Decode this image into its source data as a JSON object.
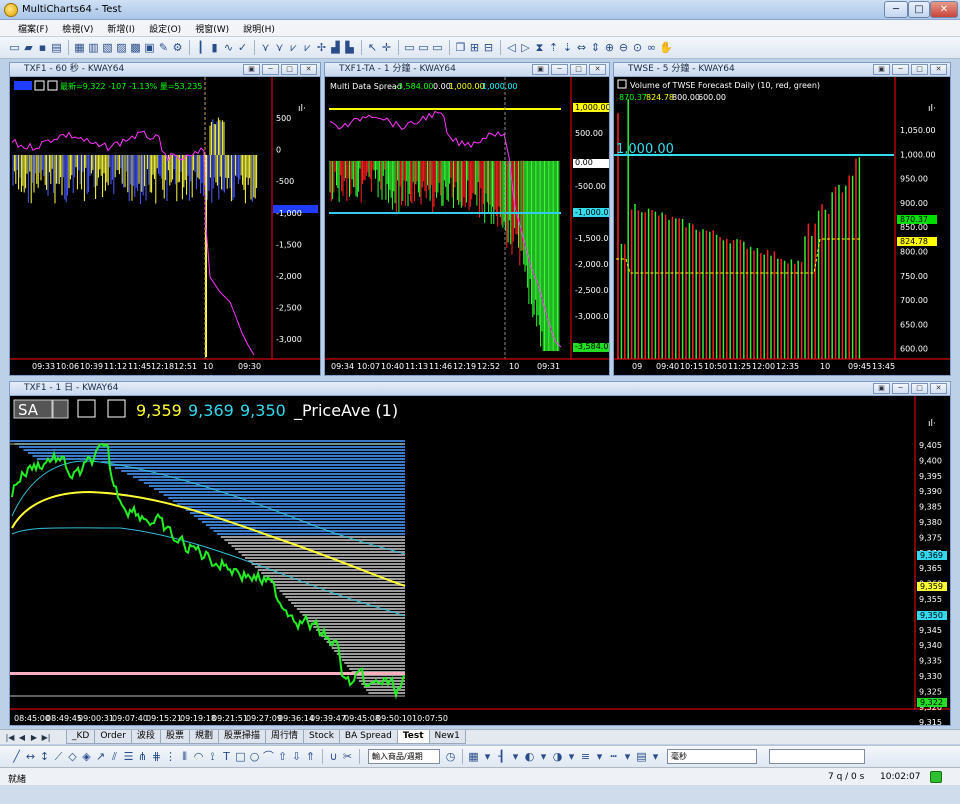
{
  "window": {
    "title": "MultiCharts64 - Test"
  },
  "menu": [
    "檔案(F)",
    "檢視(V)",
    "新增(I)",
    "設定(O)",
    "視窗(W)",
    "說明(H)"
  ],
  "panels": {
    "p1": {
      "title": "TXF1 - 60 秒 - KWAY64",
      "legend": "最新=9,322  -107  -1.13%  量=53,235",
      "yticks": [
        "500",
        "0",
        "-500",
        "-1,000",
        "-1,500",
        "-2,000",
        "-2,500",
        "-3,000"
      ],
      "xticks": [
        "09:33",
        "10:06",
        "10:39",
        "11:12",
        "11:45",
        "12:18",
        "12:51",
        "10",
        "09:30"
      ]
    },
    "p2": {
      "title": "TXF1-TA - 1 分鐘 - KWAY64",
      "legend_name": "Multi Data Spread",
      "legend_values": [
        "-3,584.00",
        "0.00",
        "1,000.00",
        "-1,000.00"
      ],
      "yticks": [
        "1,000.00",
        "500.00",
        "0.00",
        "-500.00",
        "-1,000.00",
        "-1,500.00",
        "-2,000.00",
        "-2,500.00",
        "-3,000.00",
        "-3,584.00"
      ],
      "xticks": [
        "09:34",
        "10:07",
        "10:40",
        "11:13",
        "11:46",
        "12:19",
        "12:52",
        "10",
        "09:31"
      ]
    },
    "p3": {
      "title": "TWSE - 5 分鐘 - KWAY64",
      "legend": "Volume of TWSE Forecast Daily  (10,  red,  green)",
      "legend_values": [
        "870.37",
        "824.78",
        "800.00",
        "600.00"
      ],
      "big_label": "1,000.00",
      "yticks": [
        "1,050.00",
        "1,000.00",
        "950.00",
        "900.00",
        "850.00",
        "800.00",
        "750.00",
        "700.00",
        "650.00",
        "600.00"
      ],
      "markers": [
        "870.37",
        "824.78"
      ],
      "xticks": [
        "09",
        "09:40",
        "10:15",
        "10:50",
        "11:25",
        "12:00",
        "12:35",
        "10",
        "09:45",
        "13:45"
      ]
    },
    "p4": {
      "title": "TXF1 - 1 日 - KWAY64",
      "sa_label": "SA",
      "values": [
        "9,359",
        "9,369",
        "9,350"
      ],
      "indicator": "_PriceAve  (1)",
      "yticks": [
        "9,405",
        "9,400",
        "9,395",
        "9,390",
        "9,385",
        "9,380",
        "9,375",
        "9,370",
        "9,365",
        "9,360",
        "9,355",
        "9,350",
        "9,345",
        "9,340",
        "9,335",
        "9,330",
        "9,325",
        "9,320",
        "9,315"
      ],
      "markers": [
        "9,369",
        "9,359",
        "9,350",
        "9,322"
      ],
      "xticks": [
        "08:45:00",
        "08:49:45",
        "09:00:31",
        "09:07:40",
        "09:15:21",
        "09:19:18",
        "09:21:51",
        "09:27:09",
        "09:36:14",
        "09:39:47",
        "09:45:08",
        "09:50:10",
        "10:07:50"
      ]
    }
  },
  "tabs": [
    "_KD",
    "Order",
    "波段",
    "股票",
    "規劃",
    "股票掃描",
    "周行情",
    "Stock",
    "BA Spread",
    "Test",
    "New1"
  ],
  "active_tab": "Test",
  "drawbar": {
    "symbol_input": "輸入商品/週期",
    "unit_select": "毫秒"
  },
  "status": {
    "left": "就緒",
    "queue": "7 q / 0 s",
    "time": "10:02:07"
  },
  "colors": {
    "yellow": "#ffff00",
    "cyan": "#00ffff",
    "green": "#00ff00",
    "red": "#ff0000",
    "magenta": "#ff00ff",
    "blue": "#3366ff"
  }
}
